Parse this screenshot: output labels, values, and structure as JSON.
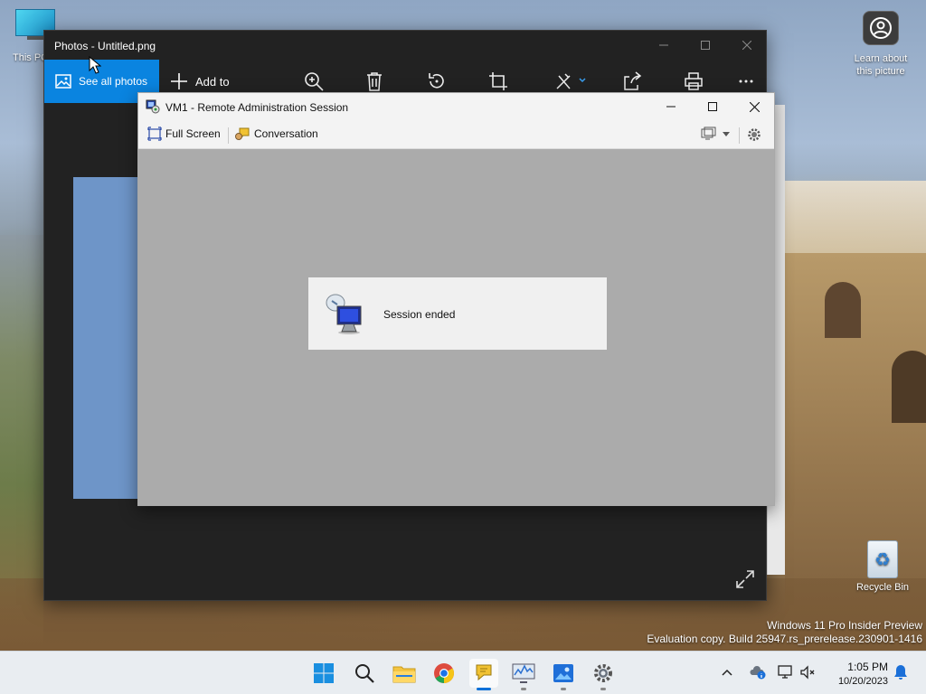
{
  "desktop": {
    "this_pc_label": "This PC",
    "learn_label": "Learn about this picture",
    "recycle_label": "Recycle Bin",
    "watermark_line1": "Windows 11 Pro Insider Preview",
    "watermark_line2": "Evaluation copy. Build 25947.rs_prerelease.230901-1416"
  },
  "photos": {
    "title": "Photos - Untitled.png",
    "see_all_label": "See all photos",
    "add_to_label": "Add to"
  },
  "rdp": {
    "title": "VM1 - Remote Administration Session",
    "fullscreen_label": "Full Screen",
    "conversation_label": "Conversation",
    "session_message": "Session ended"
  },
  "taskbar": {
    "time": "1:05 PM",
    "date": "10/20/2023"
  },
  "colors": {
    "accent": "#0a84e0",
    "photos_bg": "#222222",
    "rdp_content_bg": "#ababab"
  }
}
